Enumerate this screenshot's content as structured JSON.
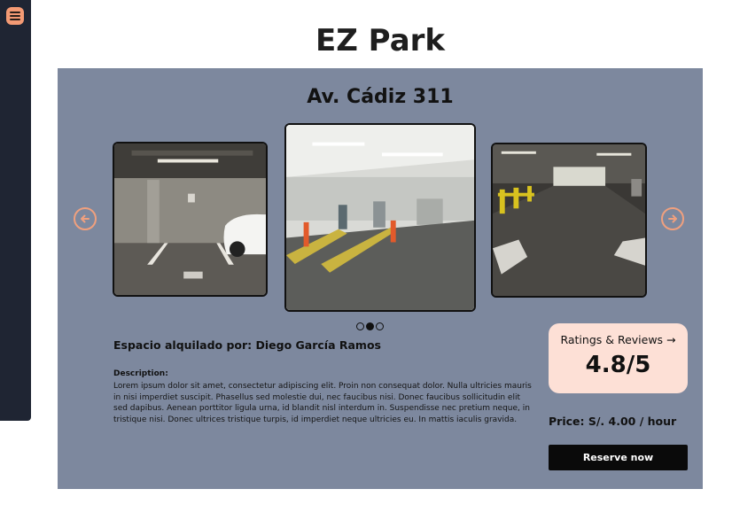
{
  "app": {
    "title": "EZ Park"
  },
  "sidebar": {
    "menu_icon": "hamburger-menu-icon"
  },
  "listing": {
    "address": "Av. Cádiz 311",
    "owner_line": "Espacio alquilado por: Diego García Ramos",
    "description_label": "Description:",
    "description_text": "Lorem ipsum dolor sit amet, consectetur adipiscing elit. Proin non consequat dolor. Nulla ultricies mauris in nisi imperdiet suscipit. Phasellus sed molestie dui, nec faucibus nisi. Donec faucibus sollicitudin elit sed dapibus. Aenean porttitor ligula urna, id blandit nisl interdum in. Suspendisse nec pretium neque, in tristique nisi. Donec ultrices tristique turpis, id imperdiet neque ultricies eu. In mattis iaculis gravida.",
    "price": "Price: S/. 4.00 / hour",
    "reserve_label": "Reserve now"
  },
  "carousel": {
    "prev_icon": "arrow-left-circle-icon",
    "next_icon": "arrow-right-circle-icon",
    "slide_count": 3,
    "active_index": 1
  },
  "ratings": {
    "title": "Ratings & Reviews →",
    "value": "4.8/5"
  },
  "colors": {
    "sidebar": "#1f2533",
    "accent": "#f39a74",
    "panel": "#7d889e",
    "ratings_card": "#fde0d6",
    "button": "#0a0a0a"
  }
}
